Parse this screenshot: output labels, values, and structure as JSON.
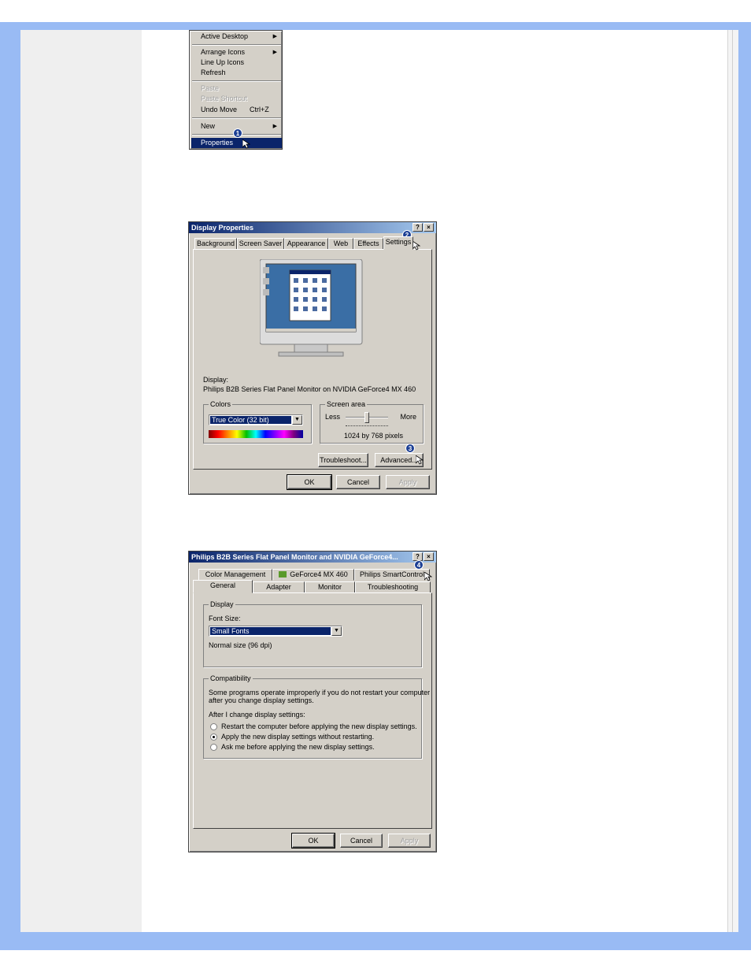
{
  "context_menu": {
    "items": [
      {
        "label": "Active Desktop",
        "submenu": true
      },
      {
        "label": "Arrange Icons",
        "submenu": true
      },
      {
        "label": "Line Up Icons"
      },
      {
        "label": "Refresh"
      },
      {
        "label": "Paste",
        "disabled": true
      },
      {
        "label": "Paste Shortcut",
        "disabled": true
      },
      {
        "label": "Undo Move",
        "accel": "Ctrl+Z"
      },
      {
        "label": "New",
        "submenu": true
      },
      {
        "label": "Properties",
        "selected": true
      }
    ],
    "step_badge": "1"
  },
  "display_properties": {
    "title": "Display Properties",
    "help_button": "?",
    "close_button": "×",
    "tabs": [
      "Background",
      "Screen Saver",
      "Appearance",
      "Web",
      "Effects",
      "Settings"
    ],
    "step_badge_settings": "2",
    "display_label": "Display:",
    "display_value": "Philips B2B Series Flat Panel Monitor on NVIDIA GeForce4 MX 460",
    "colors_label": "Colors",
    "colors_value": "True Color (32 bit)",
    "screen_area_label": "Screen area",
    "less_label": "Less",
    "more_label": "More",
    "resolution": "1024 by 768 pixels",
    "troubleshoot_button": "Troubleshoot...",
    "advanced_button": "Advanced...",
    "step_badge_advanced": "3",
    "ok_button": "OK",
    "cancel_button": "Cancel",
    "apply_button": "Apply"
  },
  "advanced_dialog": {
    "title": "Philips B2B Series Flat Panel Monitor and NVIDIA GeForce4...",
    "help_button": "?",
    "close_button": "×",
    "tabs_row1": [
      "Color Management",
      "GeForce4 MX 460",
      "Philips SmartControl"
    ],
    "tabs_row2": [
      "General",
      "Adapter",
      "Monitor",
      "Troubleshooting"
    ],
    "step_badge": "4",
    "display_group": "Display",
    "font_size_label": "Font Size:",
    "font_size_value": "Small Fonts",
    "font_size_note": "Normal size (96 dpi)",
    "compat_group": "Compatibility",
    "compat_text_1": "Some programs operate improperly if you do not restart your computer",
    "compat_text_2": "after you change display settings.",
    "after_change_label": "After I change display settings:",
    "options": [
      {
        "label": "Restart the computer before applying the new display settings.",
        "checked": false
      },
      {
        "label": "Apply the new display settings without restarting.",
        "checked": true
      },
      {
        "label": "Ask me before applying the new display settings.",
        "checked": false
      }
    ],
    "ok_button": "OK",
    "cancel_button": "Cancel",
    "apply_button": "Apply"
  }
}
